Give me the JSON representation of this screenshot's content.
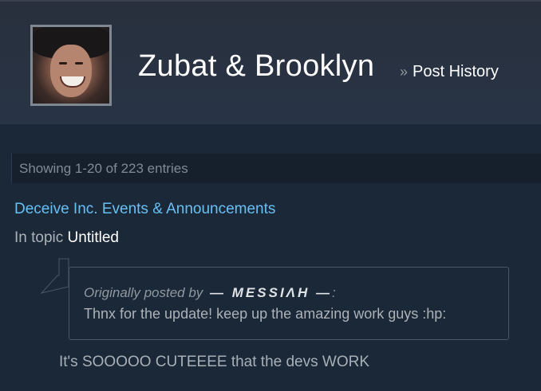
{
  "header": {
    "profile_name": "Zubat & Brooklyn",
    "separator": "»",
    "section": "Post History"
  },
  "entries": {
    "summary": "Showing 1-20 of 223 entries"
  },
  "post": {
    "forum": "Deceive Inc. Events & Announcements",
    "topic_prefix": "In topic",
    "topic_title": "Untitled",
    "quote": {
      "label": "Originally posted by",
      "author": "— MESSIΛH —",
      "colon": ":",
      "text": "Thnx for the update! keep up the amazing work guys :hp:"
    },
    "text": "It's SOOOOO CUTEEEE that the devs WORK"
  },
  "colors": {
    "background": "#1b2838",
    "link": "#66c0f4",
    "text_muted": "#acb2b8",
    "heading": "#ffffff"
  }
}
